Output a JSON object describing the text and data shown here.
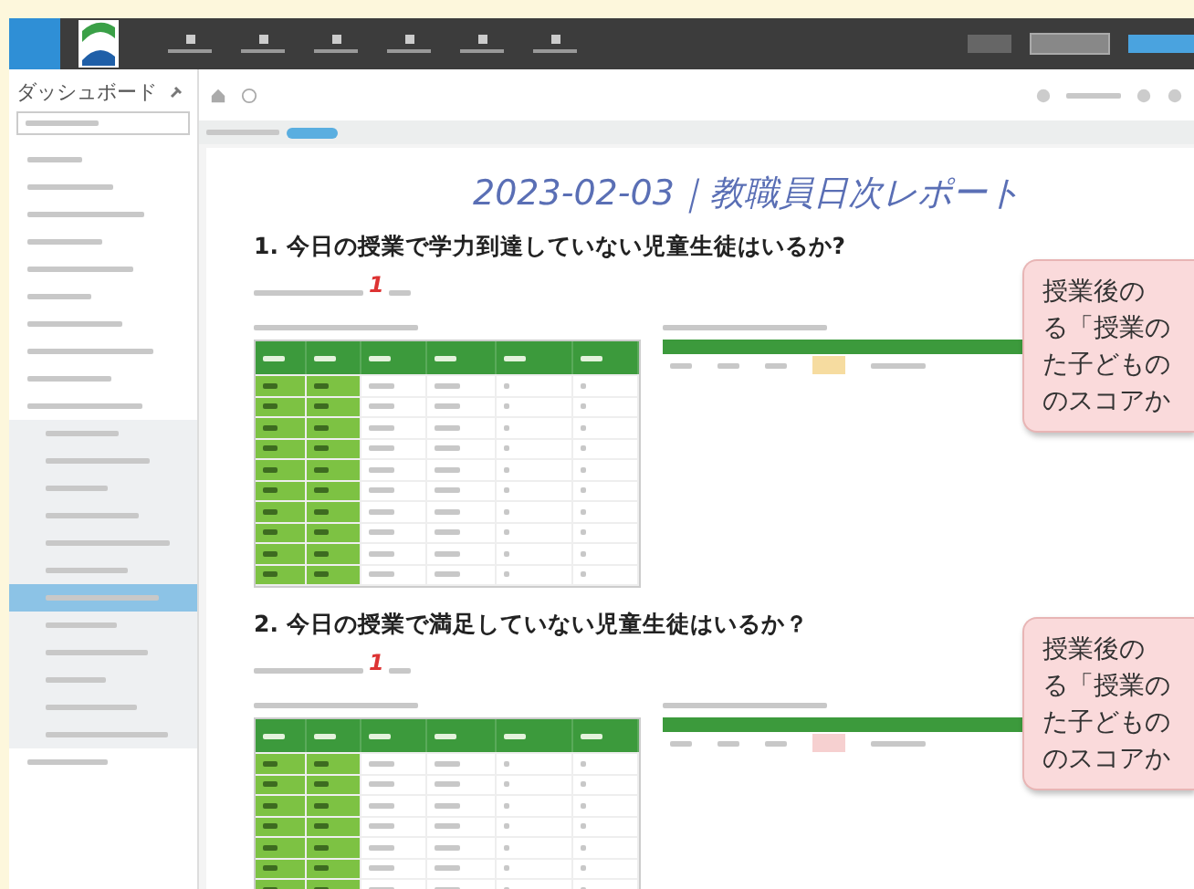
{
  "sidebar": {
    "title": "ダッシュボード",
    "items": [
      {
        "selected": false
      },
      {
        "selected": false
      },
      {
        "selected": false
      },
      {
        "selected": false
      },
      {
        "selected": false
      },
      {
        "selected": false
      },
      {
        "selected": false
      },
      {
        "selected": false
      },
      {
        "selected": false
      },
      {
        "selected": false
      },
      {
        "selected": false
      },
      {
        "selected": false
      },
      {
        "selected": false
      },
      {
        "selected": false
      },
      {
        "selected": false
      },
      {
        "selected": false
      },
      {
        "selected": true
      },
      {
        "selected": false
      },
      {
        "selected": false
      },
      {
        "selected": false
      },
      {
        "selected": false
      },
      {
        "selected": false
      },
      {
        "selected": false
      }
    ]
  },
  "report": {
    "title": "2023-02-03｜教職員日次レポート",
    "sections": [
      {
        "heading": "1. 今日の授業で学力到達していない児童生徒はいるか?",
        "count": "1",
        "callout": [
          "授業後の",
          "る「授業の",
          "た子どもの",
          "のスコアか"
        ]
      },
      {
        "heading": "2. 今日の授業で満足していない児童生徒はいるか？",
        "count": "1",
        "callout": [
          "授業後の",
          "る「授業の",
          "た子どもの",
          "のスコアか"
        ]
      }
    ]
  }
}
